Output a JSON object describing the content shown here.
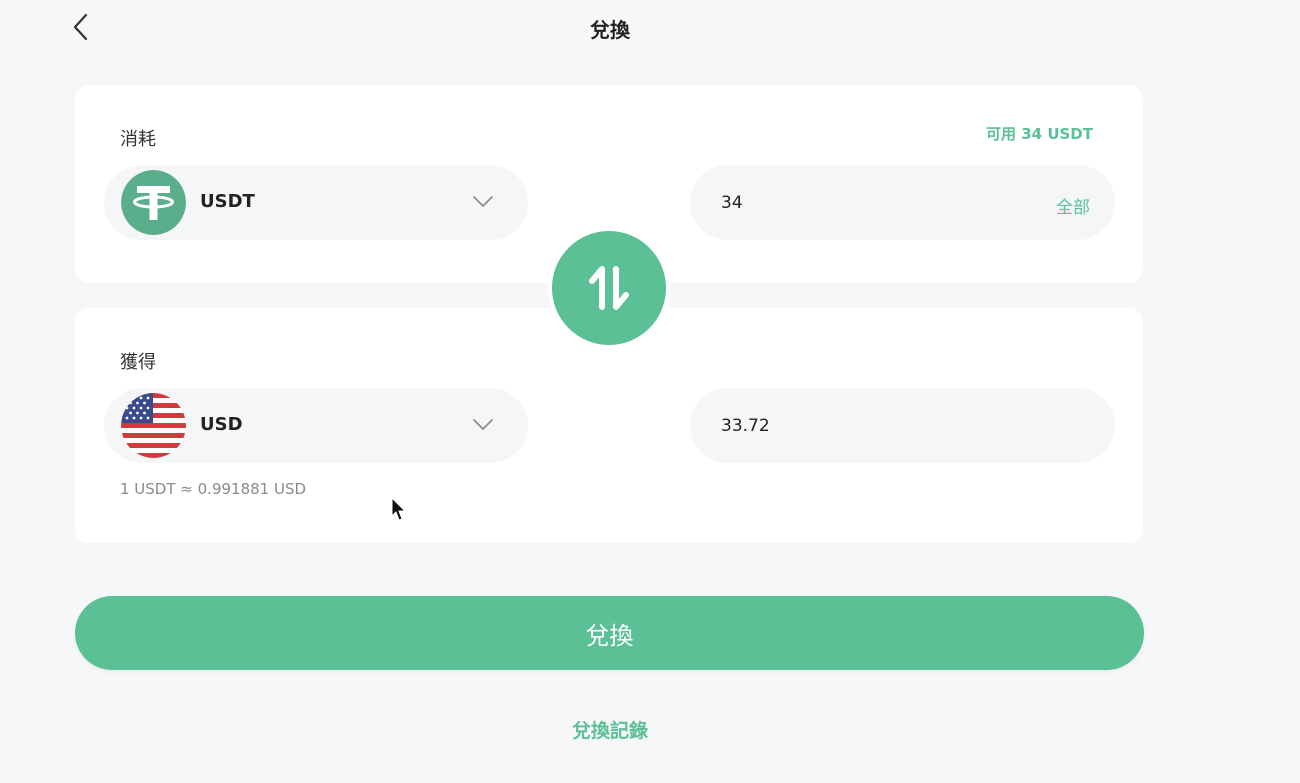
{
  "header": {
    "title": "兌換",
    "back_icon": "chevron-left-icon"
  },
  "spend": {
    "label": "消耗",
    "available": "可用 34 USDT",
    "currency": "USDT",
    "currency_icon": "tether-icon",
    "amount": "34",
    "all_label": "全部"
  },
  "swap": {
    "icon": "swap-arrows-icon"
  },
  "receive": {
    "label": "獲得",
    "currency": "USD",
    "currency_icon": "us-flag-icon",
    "amount": "33.72",
    "rate": "1 USDT ≈ 0.991881 USD"
  },
  "actions": {
    "submit_label": "兌換",
    "history_label": "兌換記錄"
  },
  "colors": {
    "accent": "#5bc096",
    "tether": "#5aae8c",
    "background": "#f6f7f8",
    "card": "#ffffff"
  }
}
